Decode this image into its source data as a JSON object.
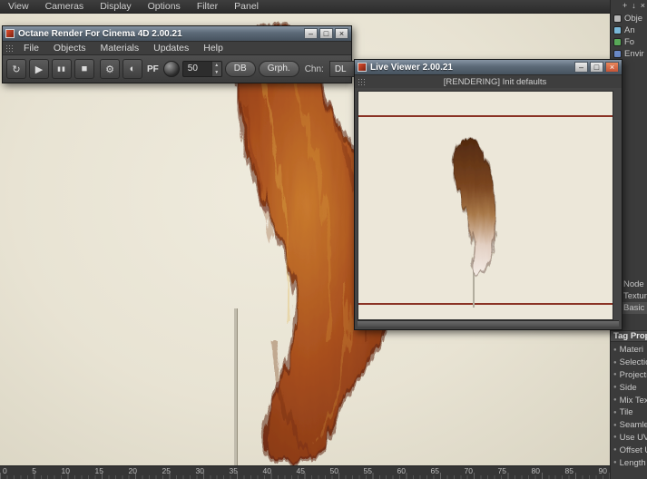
{
  "menubar": {
    "items": [
      "View",
      "Cameras",
      "Display",
      "Options",
      "Filter",
      "Panel"
    ]
  },
  "window_buttons": {
    "minimize": "–",
    "maximize": "□",
    "close": "×"
  },
  "octane_window": {
    "title": "Octane Render For Cinema 4D 2.00.21",
    "menu_items": [
      "File",
      "Objects",
      "Materials",
      "Updates",
      "Help"
    ],
    "toolbar": {
      "pf_label": "PF",
      "spinner_value": "50",
      "db_button": "DB",
      "graph_button": "Grph.",
      "channel_label": "Chn:",
      "channel_value": "DL"
    }
  },
  "live_viewer": {
    "title": "Live Viewer 2.00.21",
    "status_text": "[RENDERING] Init defaults"
  },
  "right_panel": {
    "object_items": [
      "Obje",
      "An",
      "Fo",
      "Envir"
    ],
    "section_items": [
      "Node",
      "Textur",
      "Basic"
    ],
    "tag_header": "Tag Prope",
    "property_items": [
      "Materi",
      "Selection",
      "Projectio",
      "Side",
      "Mix Textu",
      "Tile",
      "Seamless",
      "Use UVW",
      "Offset U",
      "Length U"
    ]
  },
  "timeline": {
    "ticks": [
      "0",
      "5",
      "10",
      "15",
      "20",
      "25",
      "30",
      "35",
      "40",
      "45",
      "50",
      "55",
      "60",
      "65",
      "70",
      "75",
      "80",
      "85",
      "90"
    ]
  },
  "icons": {
    "restart": "↻",
    "play": "▶",
    "pause": "▮▮",
    "stop": "■",
    "gear": "⚙",
    "shading": "◐",
    "spinner_up": "▲",
    "spinner_down": "▼",
    "dropdown_arrow": "▼",
    "bullet": "●",
    "vp_pan": "+",
    "vp_dolly": "↓",
    "vp_rotate": "×"
  },
  "colors": {
    "viewport_bg": "#eae5d6",
    "tail_core": "#c97a2e",
    "tail_mid": "#a84f1e",
    "tail_deep": "#8a3a16",
    "tail_edge": "#722a12",
    "fur_highlight": "#e2b34a",
    "lv_tail_top": "#52290f",
    "lv_tail_upper": "#7a4520",
    "lv_tail_mid": "#a87848",
    "lv_tail_lower": "#e2cfc2",
    "lv_tail_bottom": "#f4ece6",
    "render_line": "#8a3325"
  }
}
